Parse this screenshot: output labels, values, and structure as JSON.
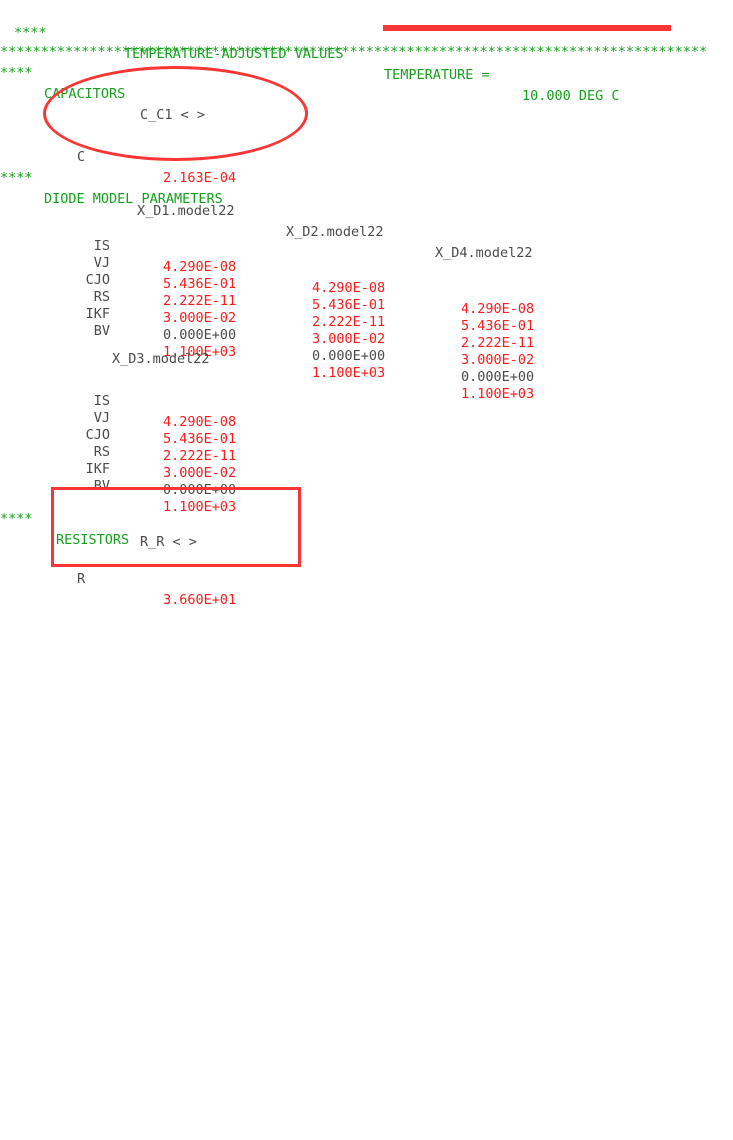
{
  "header": {
    "stars_prefix": "****",
    "title": "TEMPERATURE-ADJUSTED VALUES",
    "temp_label": "TEMPERATURE =",
    "temp_value": "10.000 DEG C",
    "separator": "***************************************************************************************"
  },
  "sections": {
    "capacitors": {
      "stars": "****",
      "heading": "CAPACITORS",
      "instance_name": "C_C1 < >",
      "param_label": "C",
      "param_value": "2.163E-04"
    },
    "diodes": {
      "stars": "****",
      "heading": "DIODE MODEL PARAMETERS",
      "table1": {
        "columns": [
          "X_D1.model22",
          "X_D2.model22",
          "X_D4.model22"
        ],
        "rows": [
          {
            "label": "IS",
            "values": [
              "4.290E-08",
              "4.290E-08",
              "4.290E-08"
            ]
          },
          {
            "label": "VJ",
            "values": [
              "5.436E-01",
              "5.436E-01",
              "5.436E-01"
            ]
          },
          {
            "label": "CJO",
            "values": [
              "2.222E-11",
              "2.222E-11",
              "2.222E-11"
            ]
          },
          {
            "label": "RS",
            "values": [
              "3.000E-02",
              "3.000E-02",
              "3.000E-02"
            ]
          },
          {
            "label": "IKF",
            "values": [
              "0.000E+00",
              "0.000E+00",
              "0.000E+00"
            ]
          },
          {
            "label": "BV",
            "values": [
              "1.100E+03",
              "1.100E+03",
              "1.100E+03"
            ]
          }
        ]
      },
      "table2": {
        "columns": [
          "X_D3.model22"
        ],
        "rows": [
          {
            "label": "IS",
            "values": [
              "4.290E-08"
            ]
          },
          {
            "label": "VJ",
            "values": [
              "5.436E-01"
            ]
          },
          {
            "label": "CJO",
            "values": [
              "2.222E-11"
            ]
          },
          {
            "label": "RS",
            "values": [
              "3.000E-02"
            ]
          },
          {
            "label": "IKF",
            "values": [
              "0.000E+00"
            ]
          },
          {
            "label": "BV",
            "values": [
              "1.100E+03"
            ]
          }
        ]
      }
    },
    "resistors": {
      "stars": "****",
      "heading": "RESISTORS",
      "instance_name": "R_R < >",
      "param_label": "R",
      "param_value": "3.660E+01"
    }
  },
  "annotations": {
    "temperature_underline": "red-underline",
    "capacitor_ellipse": "red-ellipse",
    "resistor_rect": "red-rectangle"
  },
  "colors": {
    "green": "#15a01c",
    "red": "#fb1b1b",
    "gray": "#4a4a4a",
    "annotation": "#f93535"
  }
}
